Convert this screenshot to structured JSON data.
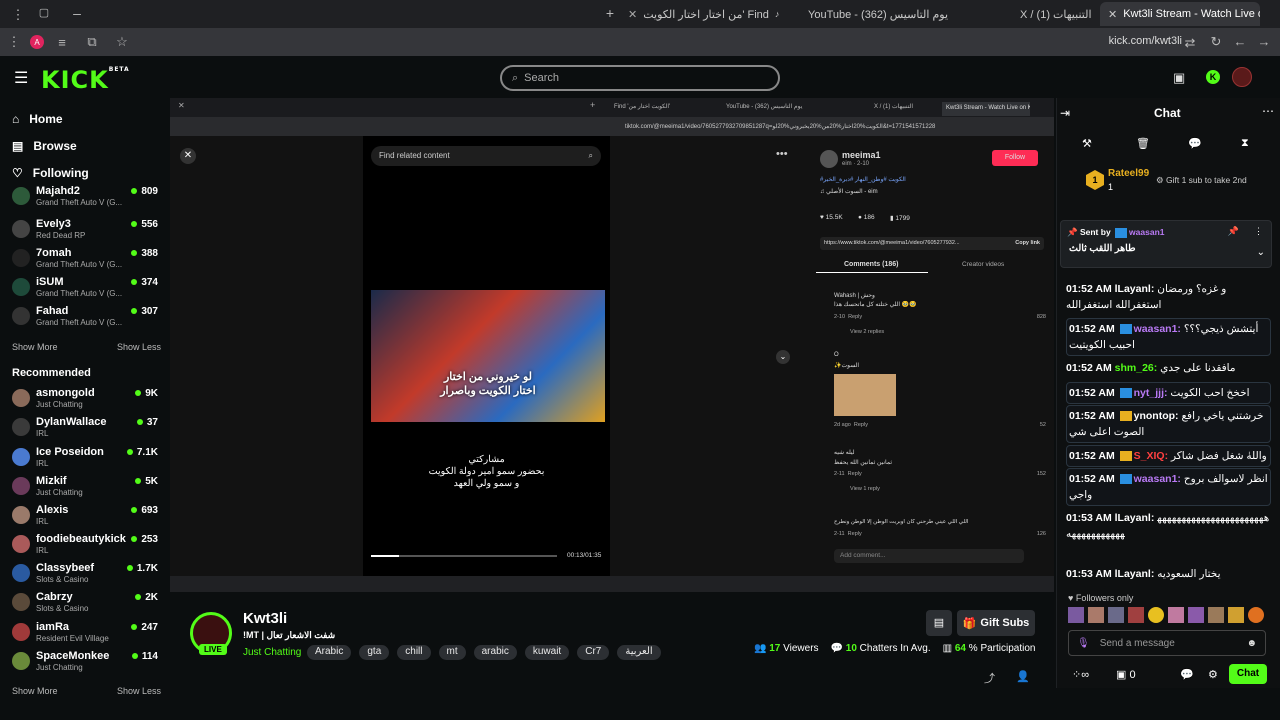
{
  "browser": {
    "tabs": [
      {
        "label": "من اختار اختار الكويت' Find"
      },
      {
        "label": "YouTube - يوم التاسيس (362)"
      },
      {
        "label": "X / التنبيهات (1)"
      },
      {
        "label": "Kwt3li Stream - Watch Live on K"
      }
    ],
    "url": "kick.com/kwt3li",
    "profile_letter": "A"
  },
  "topnav": {
    "logo": "KICK",
    "logo_sup": "BETA",
    "search_placeholder": "Search"
  },
  "sidebar": {
    "nav": [
      {
        "label": "Home"
      },
      {
        "label": "Browse"
      },
      {
        "label": "Following"
      }
    ],
    "following": [
      {
        "name": "Majahd2",
        "game": "Grand Theft Auto V (G...",
        "viewers": "809"
      },
      {
        "name": "Evely3",
        "game": "Red Dead RP",
        "viewers": "556"
      },
      {
        "name": "7omah",
        "game": "Grand Theft Auto V (G...",
        "viewers": "388"
      },
      {
        "name": "iSUM",
        "game": "Grand Theft Auto V (G...",
        "viewers": "374"
      },
      {
        "name": "Fahad",
        "game": "Grand Theft Auto V (G...",
        "viewers": "307"
      }
    ],
    "show_more": "Show More",
    "show_less": "Show Less",
    "recommended_title": "Recommended",
    "recommended": [
      {
        "name": "asmongold",
        "game": "Just Chatting",
        "viewers": "9K"
      },
      {
        "name": "DylanWallace",
        "game": "IRL",
        "viewers": "37"
      },
      {
        "name": "Ice Poseidon",
        "game": "IRL",
        "viewers": "7.1K"
      },
      {
        "name": "Mizkif",
        "game": "Just Chatting",
        "viewers": "5K"
      },
      {
        "name": "Alexis",
        "game": "IRL",
        "viewers": "693"
      },
      {
        "name": "foodiebeautykick",
        "game": "IRL",
        "viewers": "253"
      },
      {
        "name": "Classybeef",
        "game": "Slots & Casino",
        "viewers": "1.7K"
      },
      {
        "name": "Cabrzy",
        "game": "Slots & Casino",
        "viewers": "2K"
      },
      {
        "name": "iamRa",
        "game": "Resident Evil Village",
        "viewers": "247"
      },
      {
        "name": "SpaceMonkee",
        "game": "Just Chatting",
        "viewers": "114"
      }
    ]
  },
  "video": {
    "inner_url": "tiktok.com/@meeima1/video/7605277932709851287q=الكويت%20اختار%20من%20يخبروني%20لو&t=1771541571228",
    "inner_tabs": [
      "Find 'الكويت اختار من'",
      "YouTube - يوم التاسيس (362)",
      "X / التنبيهات (1)",
      "Kwt3li Stream - Watch Live on K"
    ],
    "find_placeholder": "Find related content",
    "overlay_line1": "لو خيروني من اختار",
    "overlay_line2": "اختار الكويت وباصرار",
    "caption_l1": "مشاركتي",
    "caption_l2": "بحضور سمو امير دولة الكويت",
    "caption_l3": "و سمو ولي العهد",
    "time": "00:13/01:35",
    "tiktok": {
      "user": "meeima1",
      "sub": "eim · 2-10",
      "follow": "Follow",
      "hashtags": "#الكويت #وطن_النهار #دبرة_الخير",
      "sound": "♫ السوت الأصلي - eim",
      "likes": "15.5K",
      "comments": "186",
      "saves": "1799",
      "link": "https://www.tiktok.com/@meeima1/video/7605277932...",
      "copy": "Copy link",
      "tab_comments": "Comments (186)",
      "tab_creator": "Creator videos",
      "c1_user": "Wahash | وحش",
      "c1_text": "اللي ختلته كل ماتحسك هذا 🥹🥹",
      "c1_likes": "828",
      "c1_date": "2-10",
      "c1_reply": "Reply",
      "c1_view": "View 2 replies",
      "c2_user": "O",
      "c2_text": "✨السوت",
      "c2_date": "2d ago",
      "c2_reply": "Reply",
      "c2_likes": "52",
      "c3_user": "ليله شيه",
      "c3_text": "ثمانين ثمانين الله يحفظ",
      "c3_date": "2-11",
      "c3_reply": "Reply",
      "c3_likes": "152",
      "c3_view": "View 1 reply",
      "c4_text": "اللي اللي عيني طرحني كان اوبريت الوطن إلا الوطن ونطرح",
      "c4_date": "2-11",
      "c4_reply": "Reply",
      "c4_likes": "126",
      "add_comment": "Add comment..."
    }
  },
  "stream": {
    "name": "Kwt3li",
    "title": "!MT | شفت الاشعار تعال",
    "category": "Just Chatting",
    "tags": [
      "Arabic",
      "gta",
      "chill",
      "mt",
      "arabic",
      "kuwait",
      "Cr7",
      "العربية"
    ],
    "live": "LIVE",
    "gift": "Gift Subs",
    "viewers": "17",
    "viewers_label": "Viewers",
    "chatters": "10",
    "chatters_label": "Chatters In Avg.",
    "participation": "64",
    "participation_label": "% Participation"
  },
  "chat": {
    "title": "Chat",
    "gifter": "Rateel99",
    "gifter_count": "1",
    "gift_hint": "Gift 1 sub to take 2nd",
    "pinned_by": "Sent by",
    "pinned_user": "waasan1",
    "pinned_text": "طاهر اللقب ثالث",
    "messages": [
      {
        "time": "01:52 AM",
        "user": "lLayanl:",
        "color": "#ffffff",
        "text": "و غزه؟ ورمضان استغفرالله استغفرالله"
      },
      {
        "time": "01:52 AM",
        "user": "waasan1:",
        "color": "#b97af5",
        "text": "أيتشش ذيجي؟؟؟ احبيب الكويتيت",
        "hl": true
      },
      {
        "time": "01:52 AM",
        "user": "shm_26:",
        "color": "#53fc18",
        "text": "مافقدنا على جدي"
      },
      {
        "time": "01:52 AM",
        "user": "nyt_jjj:",
        "color": "#b97af5",
        "text": "اخخخ احب الكويت",
        "hl": true
      },
      {
        "time": "01:52 AM",
        "user": "ynontop:",
        "color": "#ffffff",
        "text": "خرشتني ياخي رافع الصوت اعلى شي",
        "hl": true
      },
      {
        "time": "01:52 AM",
        "user": "S_XIQ:",
        "color": "#ff4040",
        "text": "واللهٰ شغل فضل شاكر",
        "hl": true
      },
      {
        "time": "01:52 AM",
        "user": "waasan1:",
        "color": "#b97af5",
        "text": "انظر لاسوالف بروح واجي",
        "hl": true
      },
      {
        "time": "01:53 AM",
        "user": "lLayanl:",
        "color": "#ffffff",
        "text": "ههههههههههههههههههههههههههههههههههه"
      },
      {
        "time": "01:53 AM",
        "user": "lLayanl:",
        "color": "#ffffff",
        "text": "يختار السعوديه"
      }
    ],
    "followers_only": "Followers only",
    "input_placeholder": "Send a message",
    "points": "0",
    "chat_button": "Chat"
  }
}
